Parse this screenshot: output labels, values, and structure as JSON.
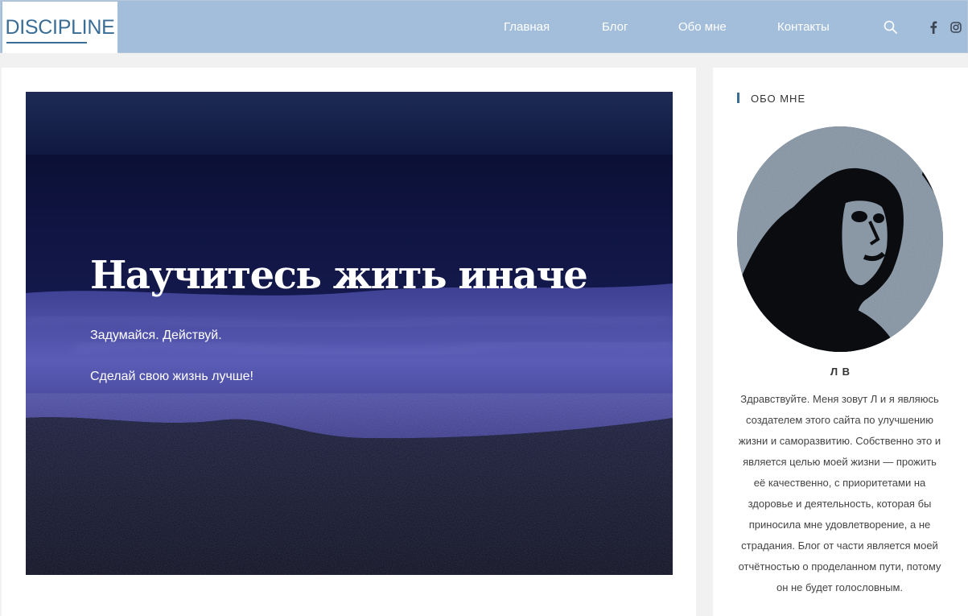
{
  "header": {
    "logo": "DISCIPLINE",
    "nav": [
      {
        "label": "Главная"
      },
      {
        "label": "Блог"
      },
      {
        "label": "Обо мне"
      },
      {
        "label": "Контакты"
      }
    ],
    "icons": [
      "search-icon",
      "facebook-icon",
      "instagram-icon"
    ],
    "colors": {
      "header_bg": "#a3bedb",
      "brand": "#3a6d96"
    }
  },
  "hero": {
    "title": "Научитесь жить иначе",
    "line1": "Задумайся. Действуй.",
    "line2": "Сделай свою жизнь лучше!"
  },
  "sidebar": {
    "widget_title": "ОБО МНЕ",
    "author_name": "Л В",
    "bio": "Здравствуйте. Меня зовут Л и я являюсь создателем этого сайта по улучшению жизни и саморазвитию. Собственно это и является целью моей жизни — прожить её качественно, с приоритетами на здоровье и деятельность, которая бы приносила мне удовлетворение, а не страдания. Блог от части является моей отчётностью о проделанном пути, потому он не будет голословным."
  }
}
